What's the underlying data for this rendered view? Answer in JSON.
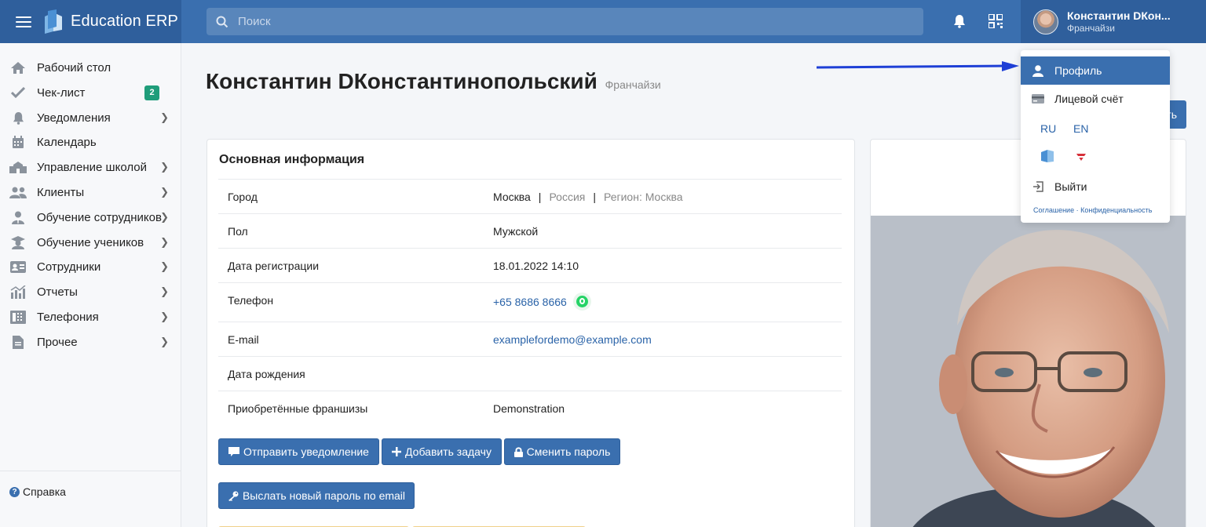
{
  "header": {
    "brand": "Education ERP",
    "search_placeholder": "Поиск",
    "user_name": "Константин DКон...",
    "user_role": "Франчайзи"
  },
  "sidebar": {
    "items": [
      {
        "label": "Рабочий стол",
        "icon": "home-icon",
        "chevron": false
      },
      {
        "label": "Чек-лист",
        "icon": "check-icon",
        "chevron": false,
        "badge": "2"
      },
      {
        "label": "Уведомления",
        "icon": "bell-icon",
        "chevron": true
      },
      {
        "label": "Календарь",
        "icon": "calendar-icon",
        "chevron": false
      },
      {
        "label": "Управление школой",
        "icon": "school-icon",
        "chevron": true
      },
      {
        "label": "Клиенты",
        "icon": "users-icon",
        "chevron": true
      },
      {
        "label": "Обучение сотрудников",
        "icon": "user-tie-icon",
        "chevron": true
      },
      {
        "label": "Обучение учеников",
        "icon": "graduation-icon",
        "chevron": true
      },
      {
        "label": "Сотрудники",
        "icon": "id-card-icon",
        "chevron": true
      },
      {
        "label": "Отчеты",
        "icon": "chart-icon",
        "chevron": true
      },
      {
        "label": "Телефония",
        "icon": "phone-book-icon",
        "chevron": true
      },
      {
        "label": "Прочее",
        "icon": "document-icon",
        "chevron": true
      }
    ],
    "help": "Справка"
  },
  "page": {
    "title": "Константин DКонстантинопольский",
    "subtitle": "Франчайзи"
  },
  "info_card": {
    "title": "Основная информация",
    "rows": {
      "city": {
        "label": "Город",
        "city": "Москва",
        "country": "Россия",
        "region": "Регион: Москва"
      },
      "gender": {
        "label": "Пол",
        "value": "Мужской"
      },
      "registered": {
        "label": "Дата регистрации",
        "value": "18.01.2022 14:10"
      },
      "phone": {
        "label": "Телефон",
        "value": "+65 8686 8666"
      },
      "email": {
        "label": "E-mail",
        "value": "examplefordemo@example.com"
      },
      "birthday": {
        "label": "Дата рождения",
        "value": ""
      },
      "franchises": {
        "label": "Приобретённые франшизы",
        "value": "Demonstration"
      }
    },
    "buttons": {
      "notify": "Отправить уведомление",
      "add_task": "Добавить задачу",
      "change_password": "Сменить пароль",
      "send_password": "Выслать новый пароль по email"
    }
  },
  "partial_button": "ть",
  "dropdown": {
    "profile": "Профиль",
    "account": "Лицевой счёт",
    "lang_ru": "RU",
    "lang_en": "EN",
    "logout": "Выйти",
    "agreement": "Соглашение",
    "dot": "·",
    "privacy": "Конфиденциальность"
  },
  "colors": {
    "header": "#3a6faf",
    "header_dark": "#2f5f9c",
    "accent": "#3a6faf",
    "badge": "#1f9d7a",
    "link": "#2a63a8",
    "arrow": "#1e3fd6"
  }
}
